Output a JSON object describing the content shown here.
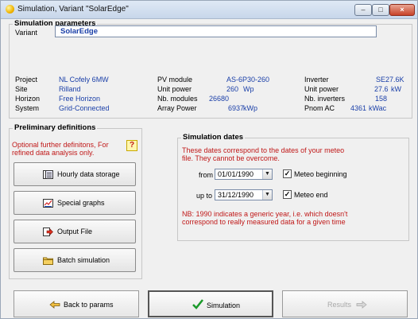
{
  "window": {
    "title": "Simulation, Variant  \"SolarEdge\"",
    "controls": {
      "minimize": "–",
      "maximize": "□",
      "close": "×"
    }
  },
  "sim_params": {
    "legend": "Simulation parameters",
    "variant_label": "Variant",
    "variant_value": "SolarEdge",
    "col1": [
      {
        "label": "Project",
        "value": "NL Cofely 6MW"
      },
      {
        "label": "Site",
        "value": "Rilland"
      },
      {
        "label": "Horizon",
        "value": "Free Horizon"
      },
      {
        "label": "System",
        "value": "Grid-Connected"
      }
    ],
    "col2": [
      {
        "label": "PV module",
        "value": "AS-6P30-260",
        "unit": ""
      },
      {
        "label": "Unit power",
        "value": "260",
        "unit": "Wp"
      },
      {
        "label": "Nb. modules",
        "value": "26680",
        "unit": ""
      },
      {
        "label": "Array Power",
        "value": "6937",
        "unit": "kWp"
      }
    ],
    "col3": [
      {
        "label": "Inverter",
        "value": "SE27.6K",
        "unit": ""
      },
      {
        "label": "Unit power",
        "value": "27.6",
        "unit": "kW"
      },
      {
        "label": "Nb. inverters",
        "value": "158",
        "unit": ""
      },
      {
        "label": "Pnom AC",
        "value": "4361",
        "unit": "kWac"
      }
    ]
  },
  "prelim": {
    "legend": "Preliminary definitions",
    "note_line1": "Optional further definitons, For",
    "note_line2": "refined data analysis only.",
    "help_symbol": "?",
    "buttons": {
      "hourly": "Hourly data storage",
      "special": "Special graphs",
      "output": "Output File",
      "batch": "Batch simulation"
    }
  },
  "dates": {
    "legend": "Simulation dates",
    "note_line1": "These dates correspond to the dates of your meteo",
    "note_line2": "file. They cannot be overcome.",
    "from_label": "from",
    "from_value": "01/01/1990",
    "upto_label": "up to",
    "upto_value": "31/12/1990",
    "meteo_begin": "Meteo beginning",
    "meteo_end": "Meteo end",
    "meteo_begin_checked": true,
    "meteo_end_checked": true,
    "nb_line1": "NB: 1990 indicates a generic year, i.e. which doesn't",
    "nb_line2": "correspond to really measured data for a given time"
  },
  "footer": {
    "back": "Back to params",
    "simulate": "Simulation",
    "results": "Results"
  }
}
